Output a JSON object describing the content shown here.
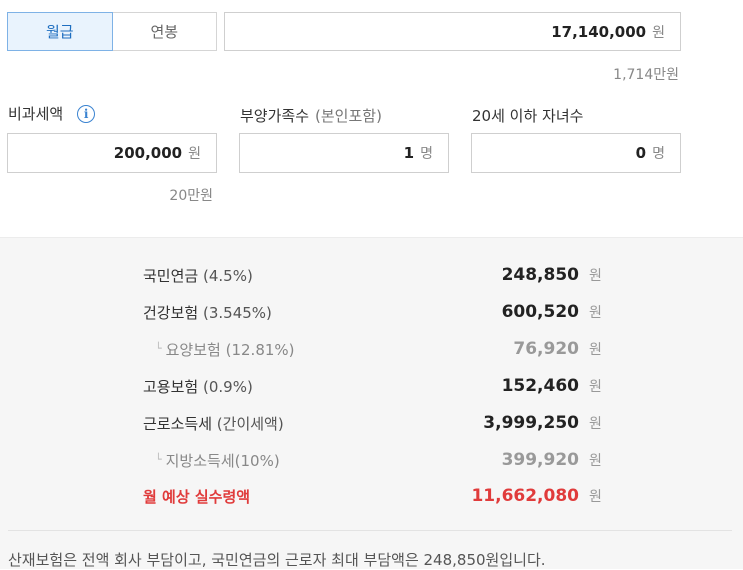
{
  "pay_type": {
    "options": [
      "월급",
      "연봉"
    ],
    "selected": "월급"
  },
  "salary": {
    "value": "17,140,000",
    "unit": "원",
    "hint": "1,714만원"
  },
  "nontaxable": {
    "label": "비과세액",
    "value": "200,000",
    "unit": "원",
    "hint": "20만원"
  },
  "dependents": {
    "label": "부양가족수",
    "sub": "(본인포함)",
    "value": "1",
    "unit": "명"
  },
  "children": {
    "label": "20세 이하 자녀수",
    "value": "0",
    "unit": "명"
  },
  "results": [
    {
      "name": "국민연금",
      "pct": "(4.5%)",
      "amount": "248,850",
      "unit": "원"
    },
    {
      "name": "건강보험",
      "pct": "(3.545%)",
      "amount": "600,520",
      "unit": "원"
    },
    {
      "name": "요양보험",
      "pct": "(12.81%)",
      "amount": "76,920",
      "unit": "원"
    },
    {
      "name": "고용보험",
      "pct": "(0.9%)",
      "amount": "152,460",
      "unit": "원"
    },
    {
      "name": "근로소득세",
      "pct": "(간이세액)",
      "amount": "3,999,250",
      "unit": "원"
    },
    {
      "name": "지방소득세(10%)",
      "pct": "",
      "amount": "399,920",
      "unit": "원"
    },
    {
      "name": "월 예상 실수령액",
      "pct": "",
      "amount": "11,662,080",
      "unit": "원"
    }
  ],
  "note": "산재보험은 전액 회사 부담이고, 국민연금의 근로자 최대 부담액은 248,850원입니다.",
  "colors": {
    "accent": "#1e6ec0",
    "total": "#e03b3b"
  },
  "icons": {
    "info": "info-icon",
    "sub_corner": "corner-icon"
  }
}
